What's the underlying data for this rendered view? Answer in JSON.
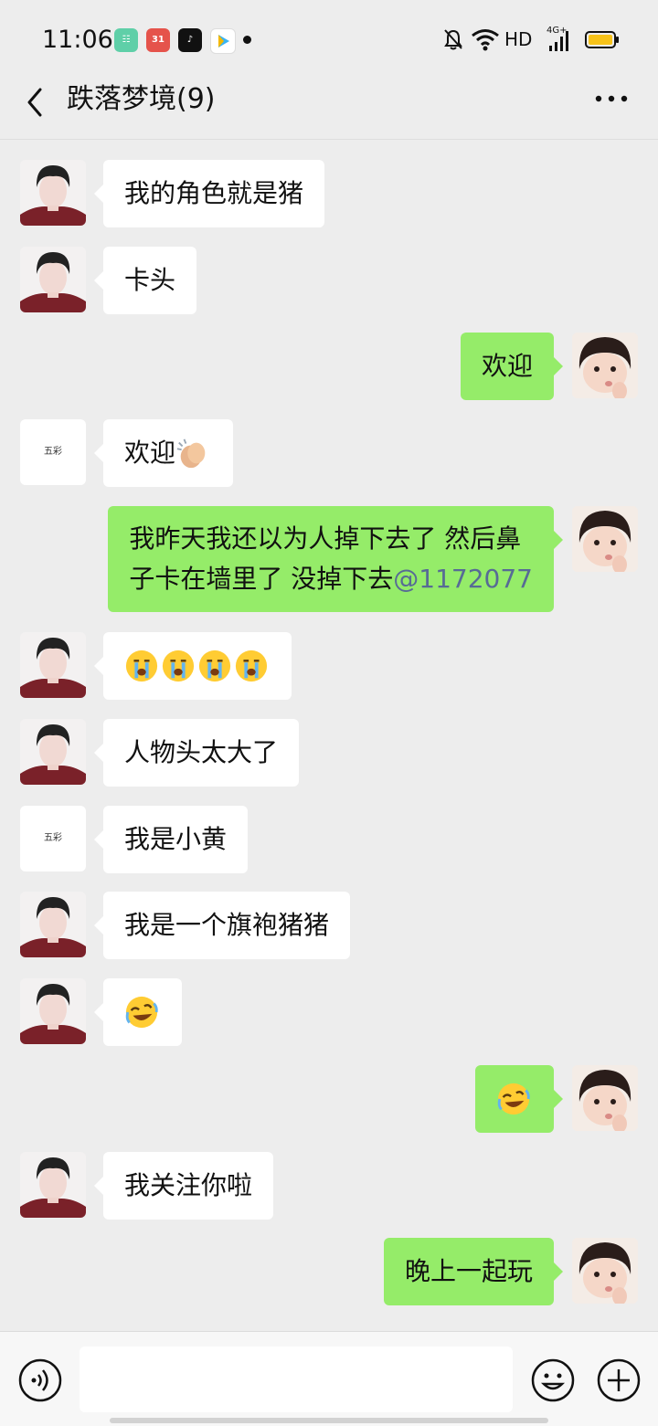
{
  "status_bar": {
    "time": "11:06",
    "network_label": "HD",
    "signal_label": "4G+",
    "notification_icons": [
      "app-store-icon",
      "calendar-icon",
      "tiktok-icon",
      "video-app-icon"
    ],
    "calendar_day": "31",
    "accent_colors": {
      "battery": "#f7c31a"
    }
  },
  "header": {
    "title": "跌落梦境(9)"
  },
  "messages": [
    {
      "side": "left",
      "avatar": "boy",
      "text": "我的角色就是猪"
    },
    {
      "side": "left",
      "avatar": "boy",
      "text": "卡头"
    },
    {
      "side": "right",
      "avatar": "baby",
      "text": "欢迎"
    },
    {
      "side": "left",
      "avatar": "logo",
      "avatar_text": "五彩",
      "text": "欢迎",
      "emoji": "clapping-hands"
    },
    {
      "side": "right",
      "avatar": "baby",
      "text_line1": "我昨天我还以为人掉下去了 然后鼻",
      "text_line2": "子卡在墙里了 没掉下去",
      "mention": "@1172077"
    },
    {
      "side": "left",
      "avatar": "boy",
      "emoji": "crying-face x4"
    },
    {
      "side": "left",
      "avatar": "boy",
      "text": "人物头太大了"
    },
    {
      "side": "left",
      "avatar": "logo",
      "avatar_text": "五彩",
      "text": "我是小黄"
    },
    {
      "side": "left",
      "avatar": "boy",
      "text": "我是一个旗袍猪猪"
    },
    {
      "side": "left",
      "avatar": "boy",
      "emoji": "rolling-laughing"
    },
    {
      "side": "right",
      "avatar": "baby",
      "emoji": "rolling-laughing"
    },
    {
      "side": "left",
      "avatar": "boy",
      "text": "我关注你啦"
    },
    {
      "side": "right",
      "avatar": "baby",
      "text": "晚上一起玩"
    }
  ],
  "input_bar": {
    "placeholder": "",
    "value": ""
  },
  "colors": {
    "background": "#ededed",
    "own_bubble": "#95ec69",
    "other_bubble": "#ffffff",
    "mention": "#576b95"
  }
}
